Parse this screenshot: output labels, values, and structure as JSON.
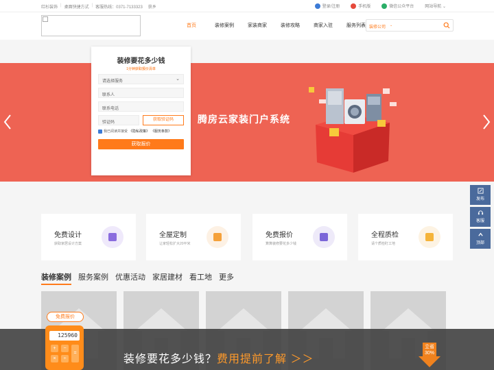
{
  "topbar": {
    "links": [
      "红杉装饰",
      "|",
      "桌面快捷方式",
      "|",
      "客服热线：0371-7133323",
      "",
      "获乡"
    ],
    "right_items": [
      {
        "label": "登录/注册",
        "color": "#3c7bd6"
      },
      {
        "label": "手机版",
        "color": "#e64a3b"
      },
      {
        "label": "微信公众平台",
        "color": "#2aae67"
      },
      {
        "label": "网站导航 ⌄",
        "color": ""
      }
    ]
  },
  "header": {
    "nav": [
      "首页",
      "装修案例",
      "家装商家",
      "装修攻略",
      "商家入驻",
      "服务列表"
    ],
    "active_index": 0,
    "search": {
      "category": "装修公司",
      "placeholder": ""
    }
  },
  "banner": {
    "title": "腾房云家装门户系统",
    "bg_color": "#ee6353"
  },
  "form": {
    "title": "装修要花多少钱",
    "subtitle": "1分钟获取报价清单",
    "service_select": "请选择服务",
    "contact_placeholder": "联系人",
    "phone_placeholder": "联系电话",
    "code_placeholder": "验证码",
    "code_button": "获取验证码",
    "agree_text": "我已阅读并接受",
    "privacy": "《隐私政策》",
    "terms": "《服务条款》",
    "submit": "获取报价"
  },
  "float": [
    {
      "label": "发布",
      "icon": "edit-icon"
    },
    {
      "label": "客服",
      "icon": "headset-icon"
    },
    {
      "label": "顶部",
      "icon": "arrow-up-icon"
    }
  ],
  "services": [
    {
      "title": "免费设计",
      "sub": "获取家居设计方案",
      "icon": "design-pen-icon",
      "color": "#efe9fb",
      "accent": "#8a6cde"
    },
    {
      "title": "全屋定制",
      "sub": "让家轻松扩大20平米",
      "icon": "cabinet-icon",
      "color": "#fdf1e4",
      "accent": "#f5a13a"
    },
    {
      "title": "免费报价",
      "sub": "算算装修要花多少钱",
      "icon": "calculator-icon",
      "color": "#eeeaf9",
      "accent": "#7b66d8"
    },
    {
      "title": "全程质检",
      "sub": "请个质检盯工地",
      "icon": "worker-helmet-icon",
      "color": "#fdf3e3",
      "accent": "#f5b43a"
    }
  ],
  "tabs": [
    "装修案例",
    "服务案例",
    "优惠活动",
    "家居建材",
    "看工地",
    "更多"
  ],
  "gallery_count": 5,
  "bottom": {
    "price_tag": "免费报价",
    "calc_display": "125960",
    "text_main": "装修要花多少钱？",
    "text_highlight": "费用提前了解 ＞＞",
    "discount_line1": "立省",
    "discount_line2": "30%"
  }
}
